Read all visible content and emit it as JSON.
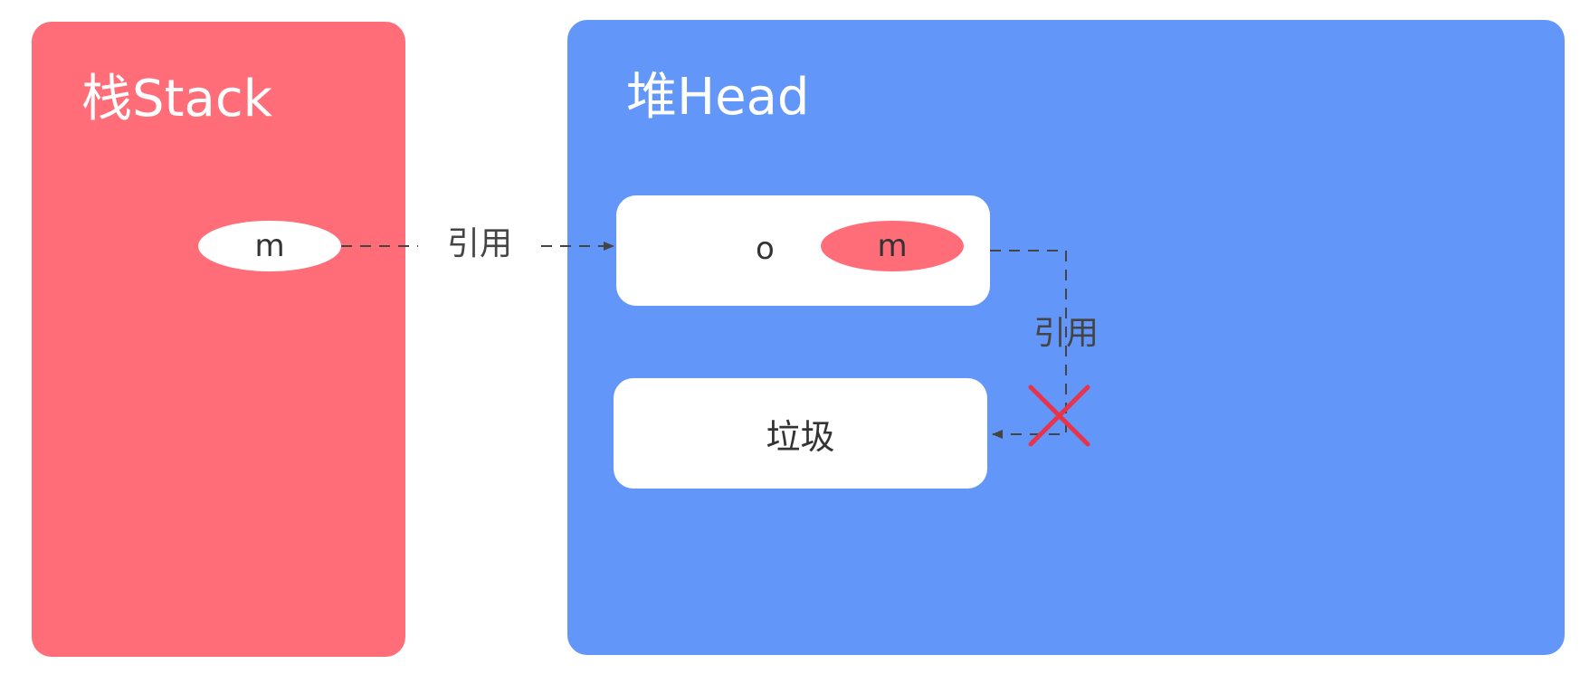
{
  "stack": {
    "title": "栈Stack",
    "variable": "m"
  },
  "heap": {
    "title": "堆Head",
    "object": {
      "name": "o",
      "field": "m"
    },
    "garbage": {
      "label": "垃圾"
    }
  },
  "references": {
    "stack_to_object": "引用",
    "field_to_garbage": "引用"
  },
  "colors": {
    "stack_fill": "#ff6e78",
    "heap_fill": "#6296f8",
    "cross": "#e8334a"
  }
}
